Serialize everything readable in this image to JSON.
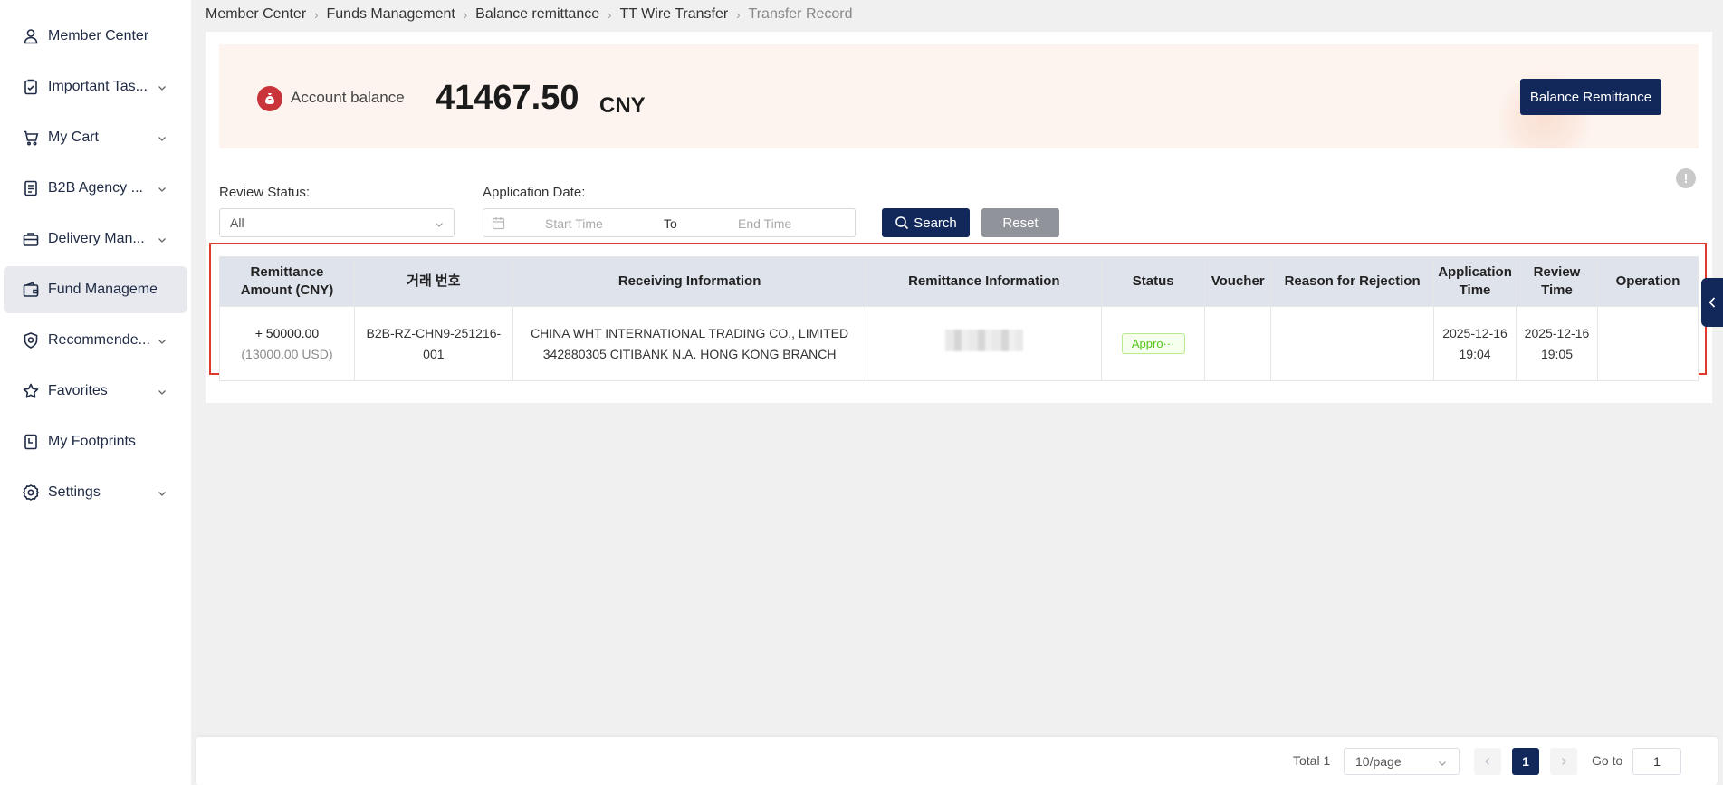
{
  "sidebar": {
    "items": [
      {
        "label": "Member Center",
        "icon": "user-icon",
        "expandable": false
      },
      {
        "label": "Important Tas...",
        "icon": "clipboard-check-icon",
        "expandable": true
      },
      {
        "label": "My Cart",
        "icon": "cart-icon",
        "expandable": true
      },
      {
        "label": "B2B Agency ...",
        "icon": "document-icon",
        "expandable": true
      },
      {
        "label": "Delivery Man...",
        "icon": "briefcase-icon",
        "expandable": true
      },
      {
        "label": "Fund Management",
        "icon": "wallet-icon",
        "expandable": false,
        "active": true
      },
      {
        "label": "Recommende...",
        "icon": "shield-star-icon",
        "expandable": true
      },
      {
        "label": "Favorites",
        "icon": "star-icon",
        "expandable": true
      },
      {
        "label": "My Footprints",
        "icon": "footprint-icon",
        "expandable": false
      },
      {
        "label": "Settings",
        "icon": "gear-icon",
        "expandable": true
      }
    ]
  },
  "breadcrumb": [
    "Member Center",
    "Funds Management",
    "Balance remittance",
    "TT Wire Transfer",
    "Transfer Record"
  ],
  "balance": {
    "label": "Account balance",
    "amount": "41467.50",
    "currency": "CNY",
    "button_label": "Balance Remittance",
    "icon": "money-bag-icon"
  },
  "filters": {
    "review_status_label": "Review Status:",
    "review_status_value": "All",
    "application_date_label": "Application Date:",
    "start_placeholder": "Start Time",
    "to_label": "To",
    "end_placeholder": "End Time",
    "search_label": "Search",
    "reset_label": "Reset"
  },
  "table": {
    "headers": [
      "Remittance Amount (CNY)",
      "거래 번호",
      "Receiving Information",
      "Remittance Information",
      "Status",
      "Voucher",
      "Reason for Rejection",
      "Application Time",
      "Review Time",
      "Operation"
    ],
    "rows": [
      {
        "amount": "+ 50000.00",
        "amount_usd": "(13000.00 USD)",
        "transaction_no": "B2B-RZ-CHN9-251216-001",
        "receiving_line1": "CHINA WHT INTERNATIONAL TRADING CO., LIMITED",
        "receiving_line2": "342880305 CITIBANK N.A. HONG KONG BRANCH",
        "status": "Appro···",
        "voucher": "",
        "reason": "",
        "application_time": "2025-12-16 19:04",
        "review_time": "2025-12-16 19:05",
        "operation": ""
      }
    ]
  },
  "pagination": {
    "total": "Total 1",
    "page_size": "10/page",
    "current_page": "1",
    "goto_label": "Go to",
    "goto_value": "1"
  },
  "colors": {
    "primary": "#13285a",
    "highlight_border": "#e03a2f",
    "status_green": "#52c41a",
    "balance_bg": "#fdf4ef"
  }
}
